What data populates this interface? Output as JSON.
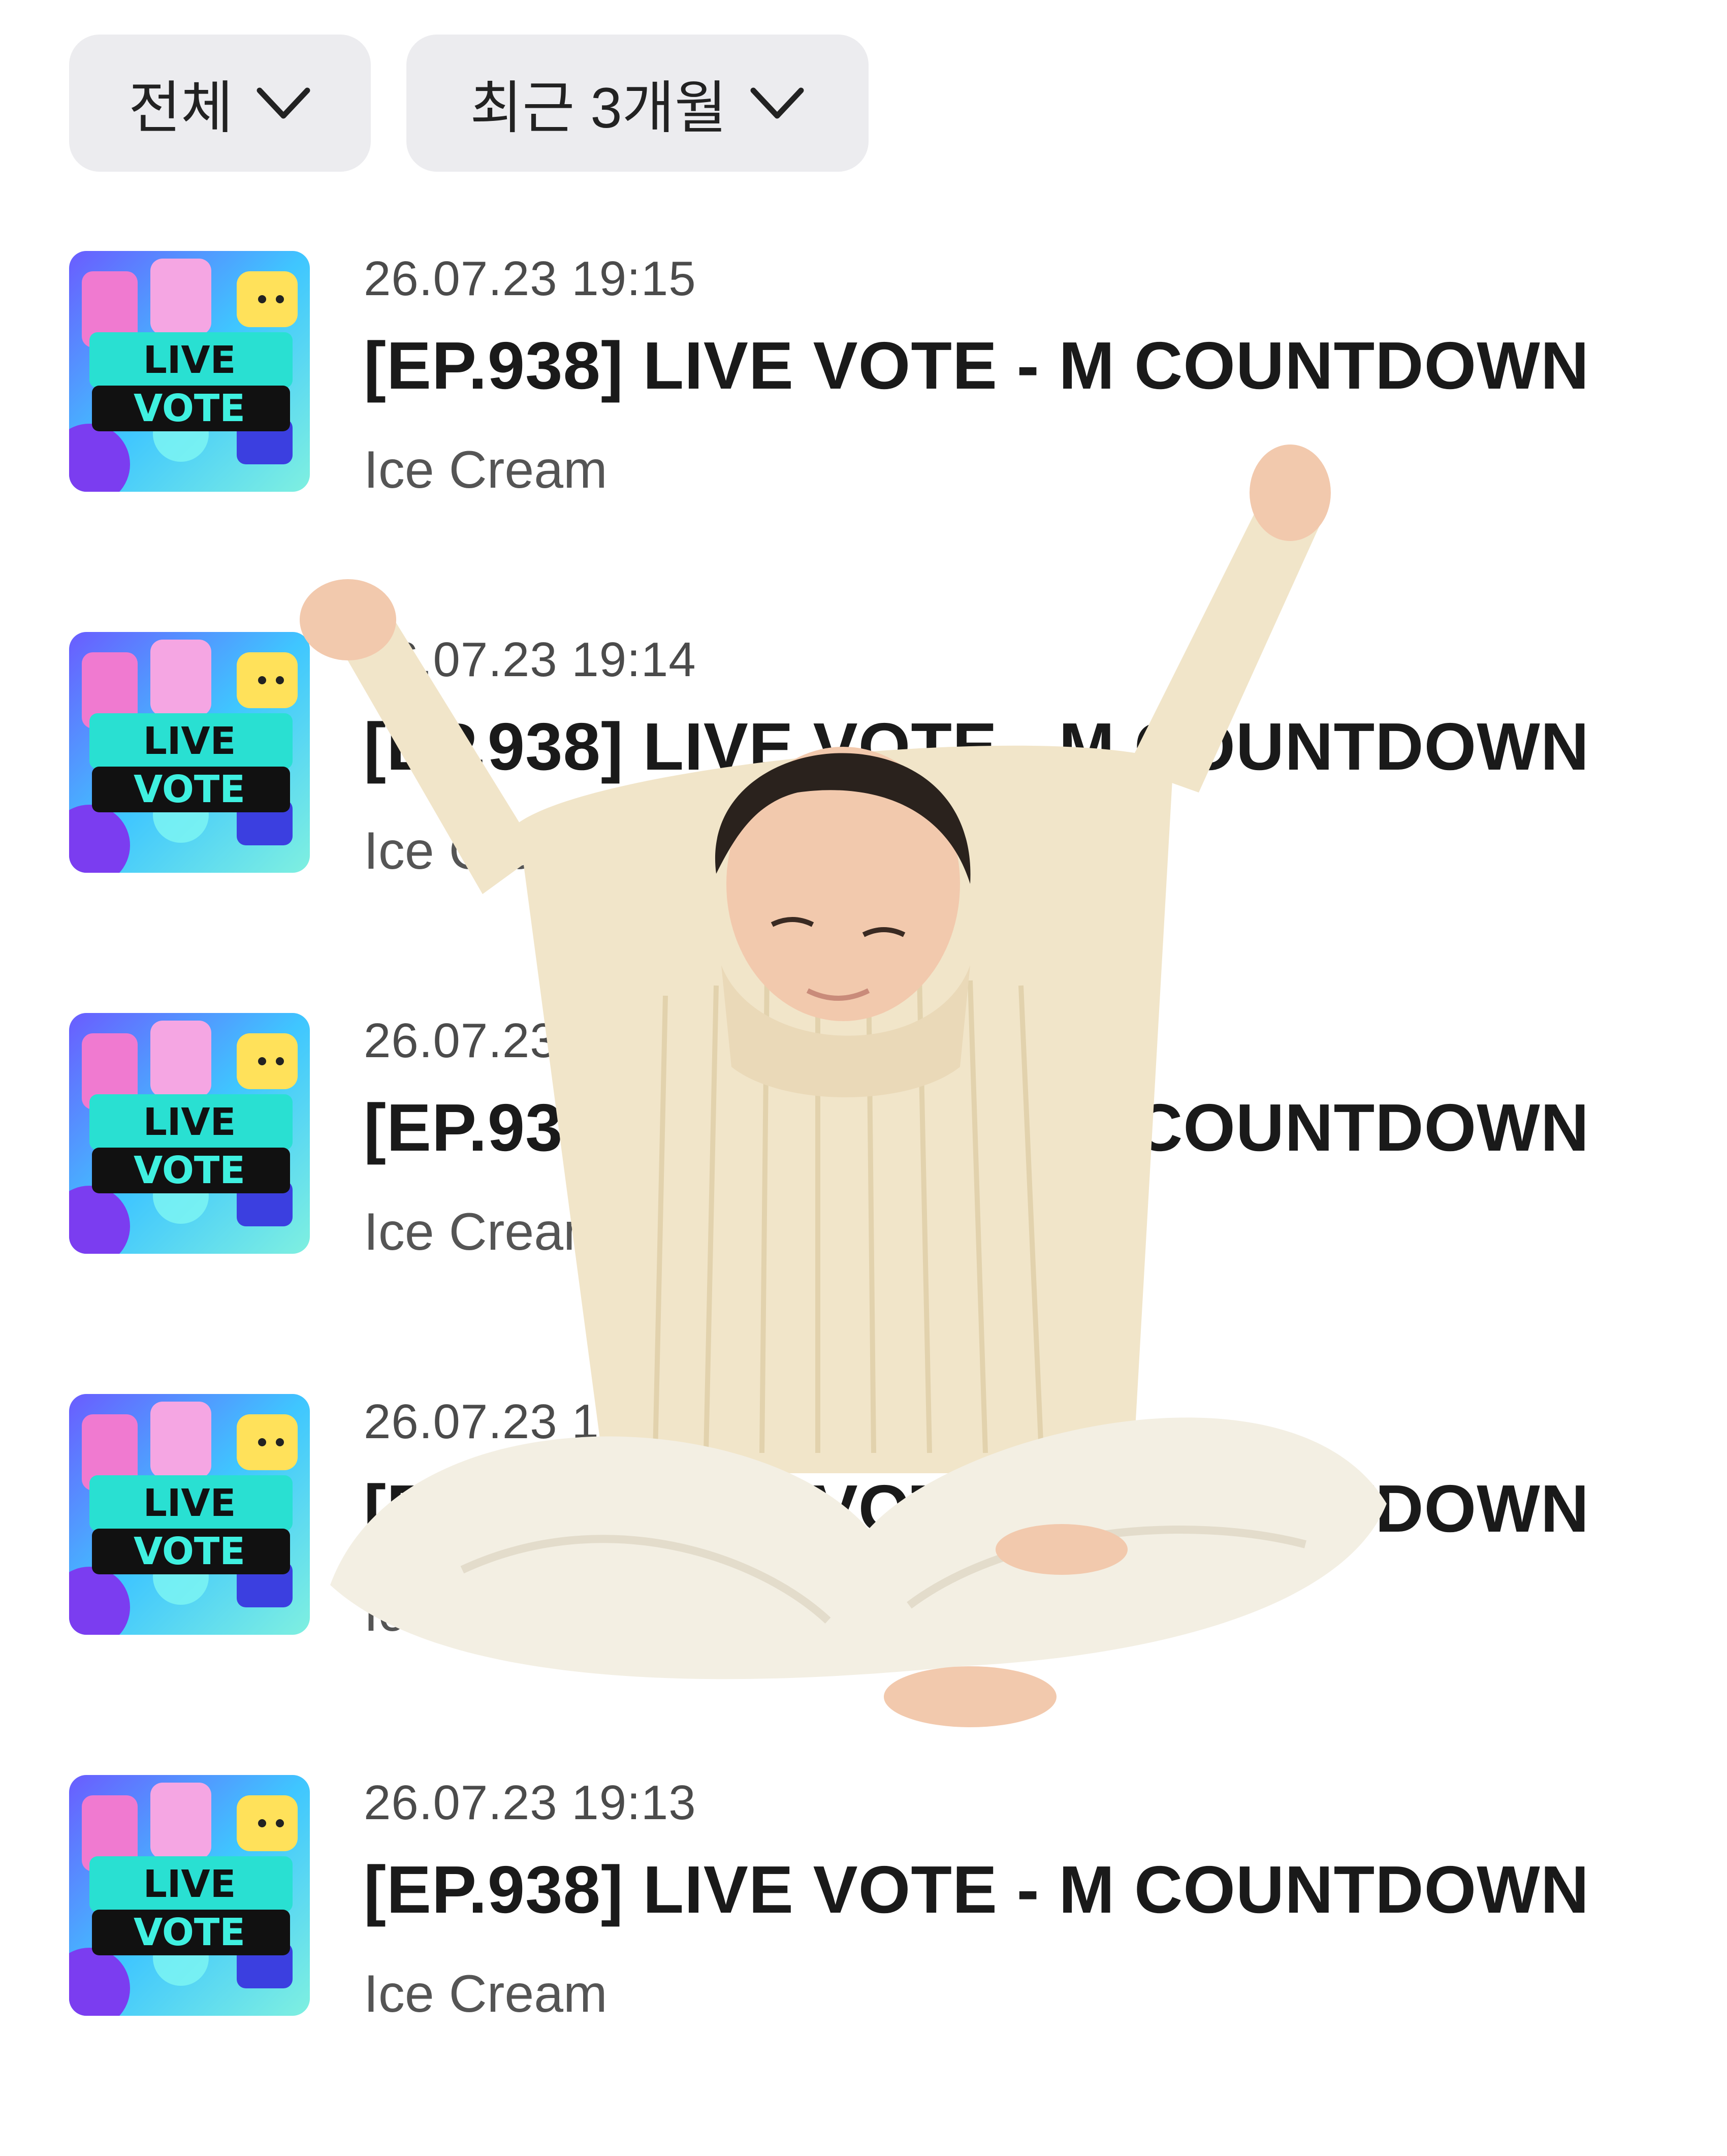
{
  "filters": {
    "category": {
      "label": "전체",
      "icon": "chevron-down-icon"
    },
    "period": {
      "label": "최근 3개월",
      "icon": "chevron-down-icon"
    }
  },
  "history": [
    {
      "timestamp": "26.07.23 19:15",
      "title": "[EP.938] LIVE VOTE - M COUNTDOWN",
      "subtitle": "Ice Cream",
      "thumbnail": {
        "line1": "LIVE",
        "line2": "VOTE"
      }
    },
    {
      "timestamp": "26.07.23 19:14",
      "title": "[EP.938] LIVE VOTE - M COUNTDOWN",
      "subtitle": "Ice Cream",
      "thumbnail": {
        "line1": "LIVE",
        "line2": "VOTE"
      }
    },
    {
      "timestamp": "26.07.23",
      "title": "[EP.938] LIVE VOTE - M COUNTDOWN",
      "subtitle": "Ice Cream",
      "thumbnail": {
        "line1": "LIVE",
        "line2": "VOTE"
      }
    },
    {
      "timestamp": "26.07.23 19:14",
      "title": "[EP.938] LIVE VOTE - M COUNTDOWN",
      "subtitle": "Ice Cream",
      "thumbnail": {
        "line1": "LIVE",
        "line2": "VOTE"
      }
    },
    {
      "timestamp": "26.07.23 19:13",
      "title": "[EP.938] LIVE VOTE - M COUNTDOWN",
      "subtitle": "Ice Cream",
      "thumbnail": {
        "line1": "LIVE",
        "line2": "VOTE"
      }
    }
  ],
  "colors": {
    "chip_bg": "#ececef",
    "title_text": "#1a1a1a",
    "meta_text": "#4b4b4b",
    "sweater": "#f1e5c9",
    "pants": "#f3efe3",
    "hair": "#2a221d",
    "skin": "#f2c9ad"
  }
}
